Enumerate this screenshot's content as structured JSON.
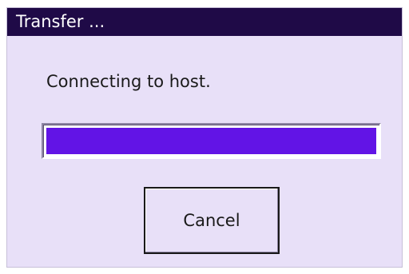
{
  "dialog": {
    "title": "Transfer ...",
    "status_text": "Connecting to host.",
    "progress": 1.0,
    "cancel_label": "Cancel"
  },
  "colors": {
    "titlebar": "#1f0a47",
    "background": "#e8e0f8",
    "progress_fill": "#6214e6"
  }
}
